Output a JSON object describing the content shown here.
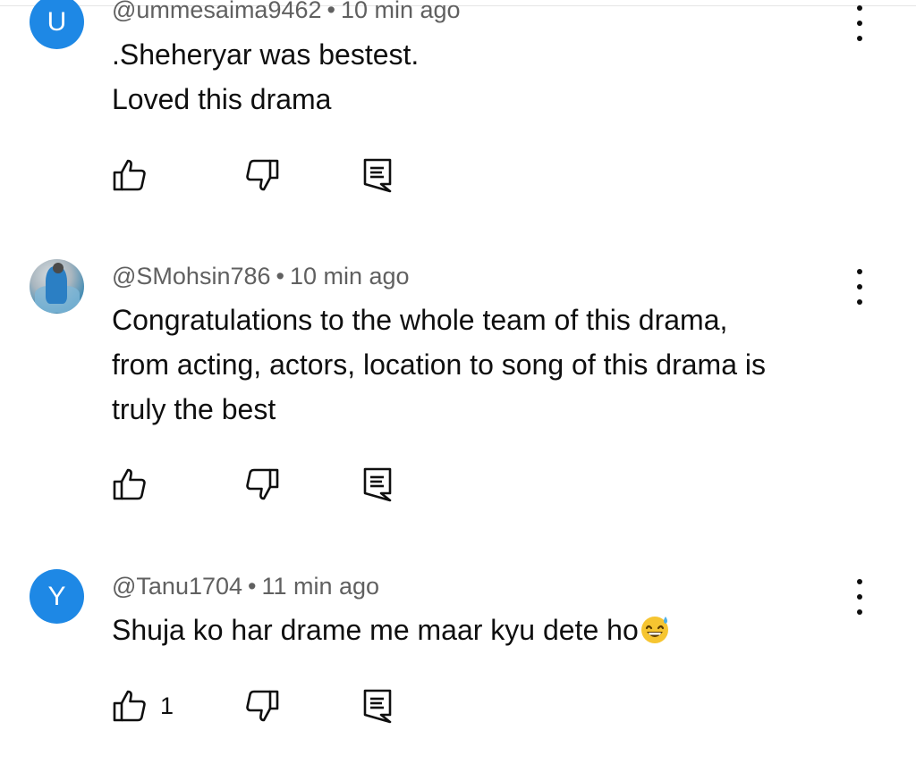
{
  "comments": [
    {
      "avatar_letter": "U",
      "avatar_color": "#1e88e5",
      "handle": "@ummesaima9462",
      "separator": "•",
      "time": "10 min ago",
      "lines": [
        ".Sheheryar was bestest.",
        "Loved this drama"
      ],
      "like_count": ""
    },
    {
      "avatar_letter": "",
      "avatar_color": "#4a8fb5",
      "handle": "@SMohsin786",
      "separator": "•",
      "time": "10 min ago",
      "lines": [
        "Congratulations to the whole team of this drama,",
        "from acting, actors, location to song of this drama is",
        "truly the best"
      ],
      "like_count": ""
    },
    {
      "avatar_letter": "Y",
      "avatar_color": "#1e88e5",
      "handle": "@Tanu1704",
      "separator": "•",
      "time": "11 min ago",
      "lines": [
        "Shuja ko har drame me maar kyu dete ho"
      ],
      "emoji_icon": "grinning-sweat-emoji",
      "like_count": "1"
    }
  ],
  "icons": {
    "like": "thumbs-up-icon",
    "dislike": "thumbs-down-icon",
    "reply": "reply-comment-icon",
    "menu": "more-vert-icon"
  }
}
